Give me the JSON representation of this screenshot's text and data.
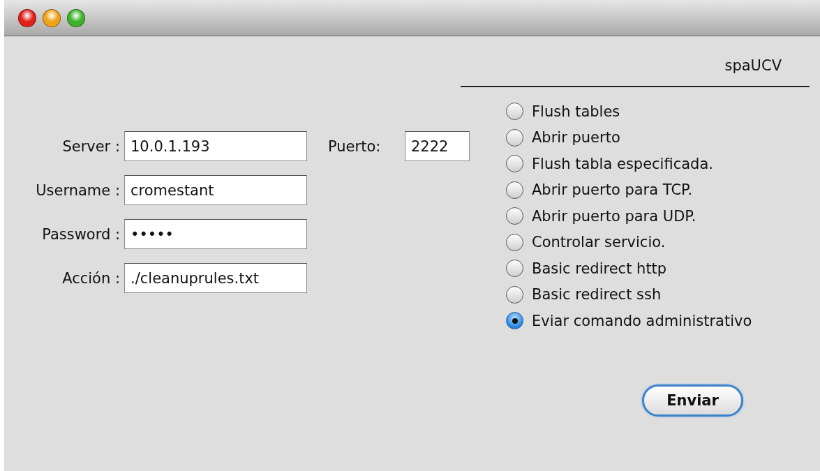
{
  "app_title": "spaUCV",
  "fields": [
    {
      "label": "Server :",
      "value": "10.0.1.193"
    },
    {
      "label": "Username :",
      "value": "cromestant"
    },
    {
      "label": "Password :",
      "value": "•••••"
    },
    {
      "label": "Acción :",
      "value": "./cleanuprules.txt"
    }
  ],
  "port": {
    "label": "Puerto:",
    "value": "2222"
  },
  "options": [
    {
      "label": "Flush tables",
      "selected": false
    },
    {
      "label": "Abrir puerto",
      "selected": false
    },
    {
      "label": "Flush tabla especificada.",
      "selected": false
    },
    {
      "label": "Abrir puerto para TCP.",
      "selected": false
    },
    {
      "label": "Abrir puerto para UDP.",
      "selected": false
    },
    {
      "label": "Controlar servicio.",
      "selected": false
    },
    {
      "label": "Basic redirect http",
      "selected": false
    },
    {
      "label": "Basic redirect ssh",
      "selected": false
    },
    {
      "label": "Eviar comando administrativo",
      "selected": true
    }
  ],
  "submit": "Enviar"
}
